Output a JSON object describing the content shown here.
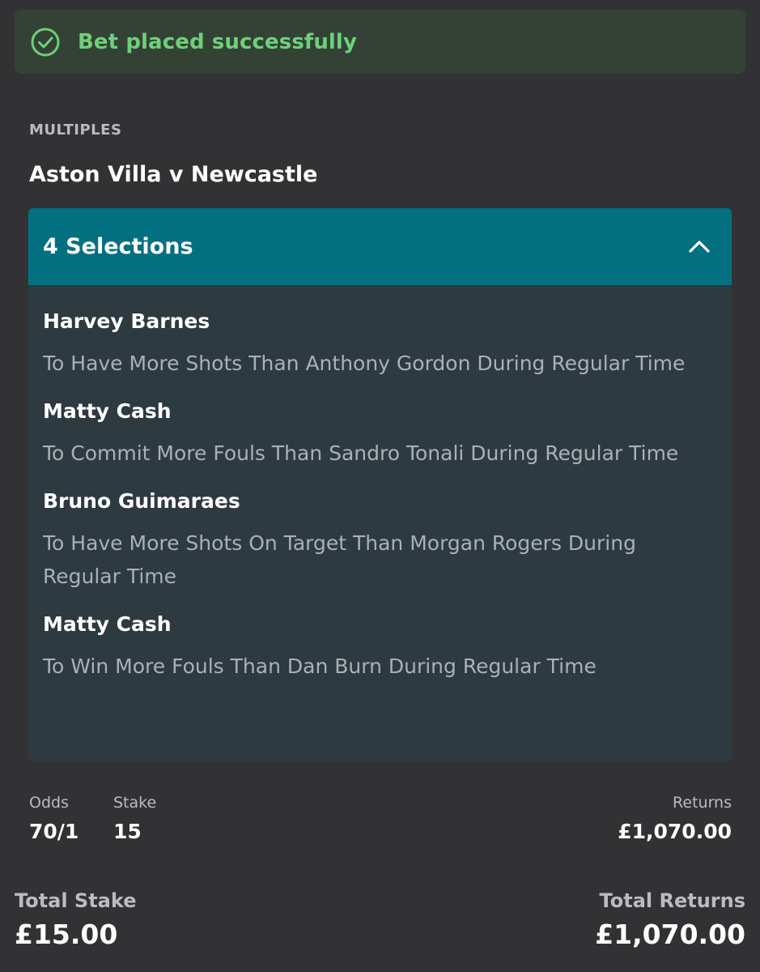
{
  "toast": {
    "message": "Bet placed successfully",
    "icon": "check-circle-icon",
    "accent": "#6ed07a"
  },
  "section_label": "MULTIPLES",
  "event_title": "Aston Villa v Newcastle",
  "selections_card": {
    "header": "4 Selections",
    "toggle_icon": "chevron-up-icon",
    "header_color": "#037081",
    "items": [
      {
        "name": "Harvey Barnes",
        "market": "To Have More Shots Than Anthony Gordon During Regular Time"
      },
      {
        "name": "Matty Cash",
        "market": "To Commit More Fouls Than Sandro Tonali During Regular Time"
      },
      {
        "name": "Bruno Guimaraes",
        "market": "To Have More Shots On Target Than Morgan Rogers During Regular Time"
      },
      {
        "name": "Matty Cash",
        "market": "To Win More Fouls Than Dan Burn During Regular Time"
      }
    ]
  },
  "summary": {
    "odds_label": "Odds",
    "odds_value": "70/1",
    "stake_label": "Stake",
    "stake_value": "15",
    "returns_label": "Returns",
    "returns_value": "£1,070.00"
  },
  "totals": {
    "stake_label": "Total Stake",
    "stake_value": "£15.00",
    "returns_label": "Total Returns",
    "returns_value": "£1,070.00"
  }
}
